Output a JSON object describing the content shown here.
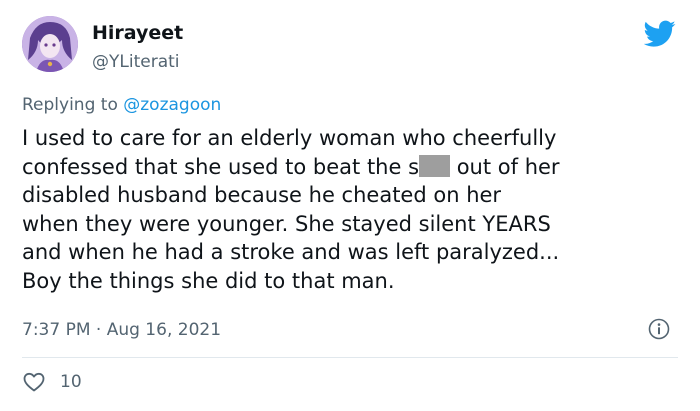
{
  "tweet": {
    "display_name": "Hirayeet",
    "handle": "@YLiterati",
    "reply_prefix": "Replying to ",
    "reply_to": "@zozagoon",
    "lines": [
      "I used to care for an elderly woman who cheerfully",
      "confessed that she used to beat the s",
      " out of her",
      "disabled husband because he cheated on her",
      "when they were younger. She stayed silent YEARS",
      "and when he had a stroke and was left paralyzed...",
      "Boy the things she did to that man."
    ],
    "timestamp": "7:37 PM · Aug 16, 2021",
    "like_count": "10"
  },
  "icons": {
    "brand": "twitter-bird-icon",
    "info": "info-icon",
    "like": "heart-icon",
    "avatar": "avatar"
  },
  "colors": {
    "brand_blue": "#1da1f2",
    "mention_blue": "#1b95e0",
    "secondary_text": "#536471",
    "censor_gray": "#9e9e9e"
  }
}
